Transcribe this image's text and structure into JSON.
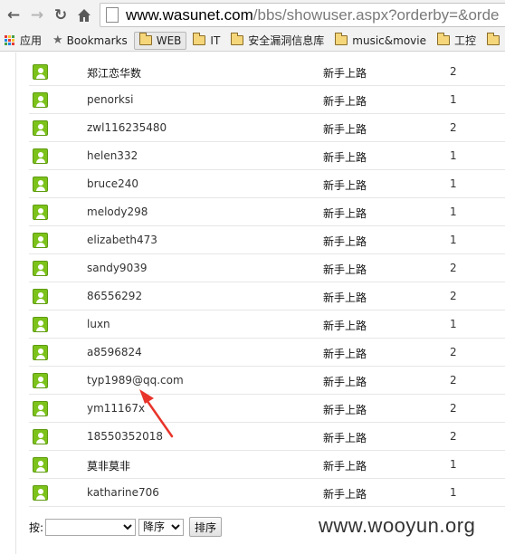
{
  "browser": {
    "url_host": "www.wasunet.com",
    "url_path": "/bbs/showuser.aspx?orderby=&orde",
    "bookmarks": [
      {
        "label": "应用",
        "icon": "apps-grid-icon"
      },
      {
        "label": "Bookmarks",
        "icon": "star-icon"
      },
      {
        "label": "WEB",
        "icon": "folder-icon",
        "active": true
      },
      {
        "label": "IT",
        "icon": "folder-icon"
      },
      {
        "label": "安全漏洞信息库",
        "icon": "folder-icon"
      },
      {
        "label": "music&movie",
        "icon": "folder-icon"
      },
      {
        "label": "工控",
        "icon": "folder-icon"
      },
      {
        "label": "",
        "icon": "folder-icon"
      }
    ]
  },
  "users": [
    {
      "name": "郑江恋华数",
      "level": "新手上路",
      "count": "2"
    },
    {
      "name": "penorksi",
      "level": "新手上路",
      "count": "1"
    },
    {
      "name": "zwl116235480",
      "level": "新手上路",
      "count": "2"
    },
    {
      "name": "helen332",
      "level": "新手上路",
      "count": "1"
    },
    {
      "name": "bruce240",
      "level": "新手上路",
      "count": "1"
    },
    {
      "name": "melody298",
      "level": "新手上路",
      "count": "1"
    },
    {
      "name": "elizabeth473",
      "level": "新手上路",
      "count": "1"
    },
    {
      "name": "sandy9039",
      "level": "新手上路",
      "count": "2"
    },
    {
      "name": "86556292",
      "level": "新手上路",
      "count": "2"
    },
    {
      "name": "luxn",
      "level": "新手上路",
      "count": "1"
    },
    {
      "name": "a8596824",
      "level": "新手上路",
      "count": "2"
    },
    {
      "name": "typ1989@qq.com",
      "level": "新手上路",
      "count": "2"
    },
    {
      "name": "ym11167x",
      "level": "新手上路",
      "count": "2"
    },
    {
      "name": "18550352018",
      "level": "新手上路",
      "count": "2"
    },
    {
      "name": "莫非莫非",
      "level": "新手上路",
      "count": "1"
    },
    {
      "name": "katharine706",
      "level": "新手上路",
      "count": "1"
    }
  ],
  "sort": {
    "label": "按:",
    "field_value": "",
    "order_value": "降序",
    "button_label": "排序"
  },
  "watermark": "www.wooyun.org",
  "colors": {
    "avatar_green": "#7cc21b",
    "annotation_arrow": "#e8342a"
  }
}
